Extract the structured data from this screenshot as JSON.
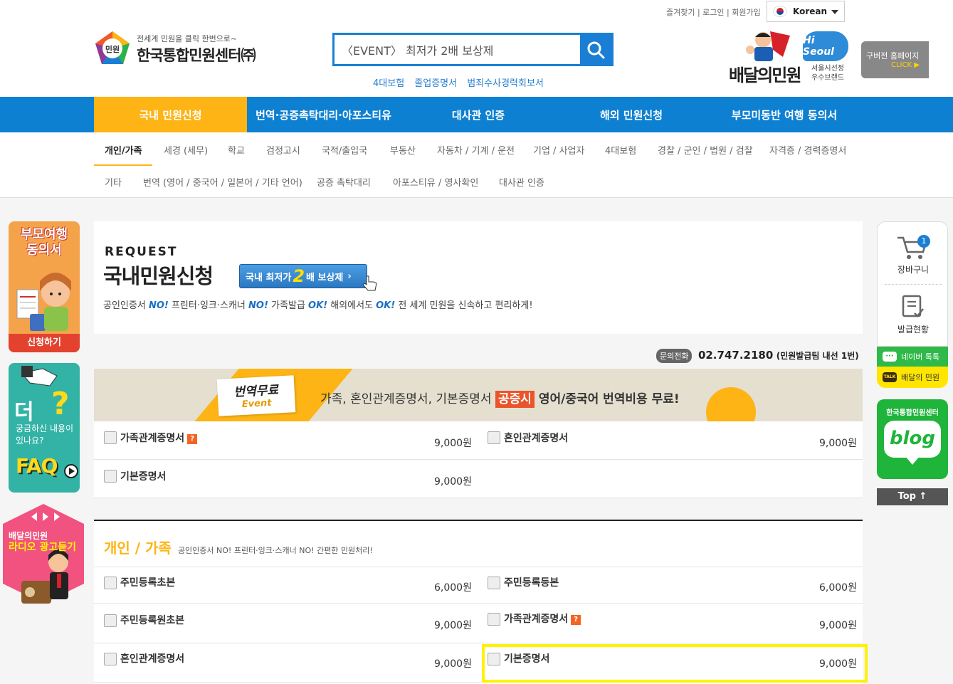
{
  "header": {
    "toplinks": "즐겨찾기 | 로그인 | 회원가입",
    "language": "Korean",
    "logo_mark": "민원",
    "logo_tagline": "전세계 민원을 클릭 한번으로~",
    "logo_name": "한국통합민원센터㈜",
    "search_value": "〈EVENT〉 최저가 2배 보상제",
    "quicklinks": [
      "4대보험",
      "졸업증명서",
      "범죄수사경력회보서"
    ],
    "brand_title": "배달의민원",
    "brand_hiseoul": "Hi Seoul",
    "brand_sub1": "서울시선정",
    "brand_sub2": "우수브랜드",
    "oldsite_label": "구버전 홈페이지",
    "oldsite_click": "CLICK ▶"
  },
  "mainnav": [
    "국내 민원신청",
    "번역·공증촉탁대리·아포스티유",
    "대사관 인증",
    "해외 민원신청",
    "부모미동반 여행 동의서"
  ],
  "subnav": {
    "row1": [
      "개인/가족",
      "세경 (세무)",
      "학교",
      "검정고시",
      "국적/출입국",
      "부동산",
      "자동차 / 기계 / 운전",
      "기업 / 사업자",
      "4대보험",
      "경찰 / 군인 / 법원 / 검찰",
      "자격증 / 경력증명서"
    ],
    "row2": [
      "기타",
      "번역 (영어 / 중국어 / 일본어 / 기타 언어)",
      "공증 촉탁대리",
      "아포스티유 / 영사확인",
      "대사관 인증"
    ]
  },
  "left_banners": {
    "b1_title": "부모여행 동의서",
    "b1_button": "신청하기",
    "b2_big": "더",
    "b2_q": "?",
    "b2_sub": "궁금하신 내용이 있나요?",
    "b2_faq": "FAQ",
    "b3_t1": "배달의민원",
    "b3_t2": "라디오 광고듣기"
  },
  "right_bar": {
    "cart_label": "장바구니",
    "cart_count": "1",
    "issue_label": "발급현황",
    "naver": "네이버 톡톡",
    "kakao": "배달의 민원",
    "kakao_icon": "TALK",
    "blog_title": "한국통합민원센터",
    "blog_word": "blog",
    "top": "Top ↑"
  },
  "request": {
    "eng": "REQUEST",
    "kor": "국내민원신청",
    "event_pre": "국내 최저가",
    "event_two": "2",
    "event_post": "배 보상제",
    "desc_parts": [
      "공인인증서 ",
      "NO!",
      " 프린터·잉크·스캐너 ",
      "NO!",
      " 가족발급 ",
      "OK!",
      " 해외에서도 ",
      "OK!",
      " 전 세계 민원을 신속하고 편리하게!"
    ]
  },
  "phone": {
    "label": "문의전화",
    "number": "02.747.2180",
    "ext": "(민원발급팀 내선 1번)"
  },
  "event_banner": {
    "card_a": "번역무료",
    "card_b": "Event",
    "text_pre": "가족, 혼인관계증명서, 기본증명서 ",
    "text_hi": "공증시",
    "text_post": " 영어/중국어 번역비용 무료!"
  },
  "table1": [
    {
      "name": "가족관계증명서",
      "help": "?",
      "price": "9,000원"
    },
    {
      "name": "혼인관계증명서",
      "help": "",
      "price": "9,000원"
    },
    {
      "name": "기본증명서",
      "help": "",
      "price": "9,000원"
    }
  ],
  "section2": {
    "title": "개인 / 가족",
    "subtitle": "공인인증서 NO! 프린터·잉크·스캐너 NO! 간편한 민원처리!"
  },
  "table2": [
    {
      "name": "주민등록초본",
      "help": "",
      "price": "6,000원"
    },
    {
      "name": "주민등록등본",
      "help": "",
      "price": "6,000원"
    },
    {
      "name": "주민등록원초본",
      "help": "",
      "price": "9,000원"
    },
    {
      "name": "가족관계증명서",
      "help": "?",
      "price": "9,000원"
    },
    {
      "name": "혼인관계증명서",
      "help": "",
      "price": "9,000원"
    },
    {
      "name": "기본증명서",
      "help": "",
      "price": "9,000원"
    }
  ],
  "colors": {
    "primary_blue": "#0e80d2",
    "accent_yellow": "#fdb414",
    "highlight": "#fff200"
  }
}
